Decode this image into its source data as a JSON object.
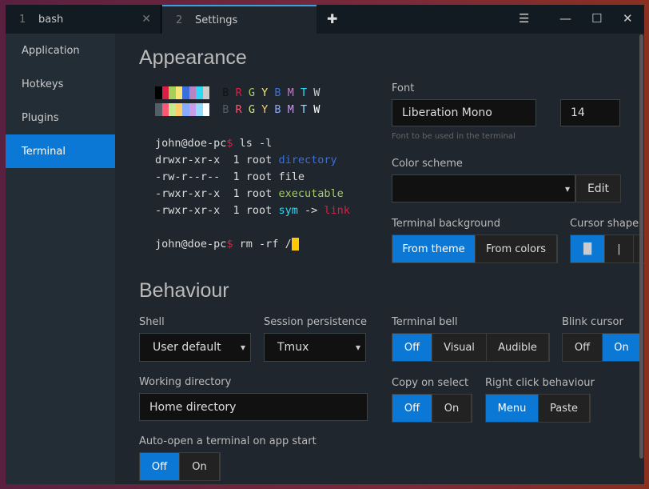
{
  "tabs": [
    {
      "num": "1",
      "label": "bash"
    },
    {
      "num": "2",
      "label": "Settings"
    }
  ],
  "sidebar": {
    "items": [
      {
        "label": "Application"
      },
      {
        "label": "Hotkeys"
      },
      {
        "label": "Plugins"
      },
      {
        "label": "Terminal"
      }
    ]
  },
  "appearance": {
    "title": "Appearance",
    "palette": {
      "normal": [
        "#000000",
        "#dc1e44",
        "#a3cf5a",
        "#f8e473",
        "#3a6fdc",
        "#b883c0",
        "#2ed8f5",
        "#cccccc"
      ],
      "bright": [
        "#555d66",
        "#ff5577",
        "#c6e88e",
        "#ffcc66",
        "#88aaff",
        "#c89ee8",
        "#8fdcff",
        "#ffffff"
      ],
      "letters": [
        "B",
        "R",
        "G",
        "Y",
        "B",
        "M",
        "T",
        "W"
      ]
    },
    "terminal": {
      "prompt": "john@doe-pc",
      "dollar": "$",
      "cmd1": " ls -l",
      "rows": [
        {
          "perm": "drwxr-xr-x  1 root ",
          "name": "directory"
        },
        {
          "perm": "-rw-r--r--  1 root ",
          "name": "file"
        },
        {
          "perm": "-rwxr-xr-x  1 root ",
          "name": "executable"
        },
        {
          "perm": "-rwxr-xr-x  1 root ",
          "name": "sym",
          "arrow": " -> ",
          "target": "link"
        }
      ],
      "cmd2": " rm -rf /"
    },
    "font_label": "Font",
    "font_value": "Liberation Mono",
    "font_size": "14",
    "font_hint": "Font to be used in the terminal",
    "color_scheme_label": "Color scheme",
    "color_scheme_value": "",
    "edit": "Edit",
    "bg_label": "Terminal background",
    "bg_options": [
      "From theme",
      "From colors"
    ],
    "cursor_label": "Cursor shape",
    "cursor_options": [
      "█",
      "|"
    ]
  },
  "behaviour": {
    "title": "Behaviour",
    "shell_label": "Shell",
    "shell_value": "User default",
    "session_label": "Session persistence",
    "session_value": "Tmux",
    "bell_label": "Terminal bell",
    "bell_options": [
      "Off",
      "Visual",
      "Audible"
    ],
    "blink_label": "Blink cursor",
    "blink_options": [
      "Off",
      "On"
    ],
    "wd_label": "Working directory",
    "wd_value": "Home directory",
    "copy_label": "Copy on select",
    "copy_options": [
      "Off",
      "On"
    ],
    "rclick_label": "Right click behaviour",
    "rclick_options": [
      "Menu",
      "Paste"
    ],
    "auto_label": "Auto-open a terminal on app start",
    "auto_options": [
      "Off",
      "On"
    ]
  }
}
